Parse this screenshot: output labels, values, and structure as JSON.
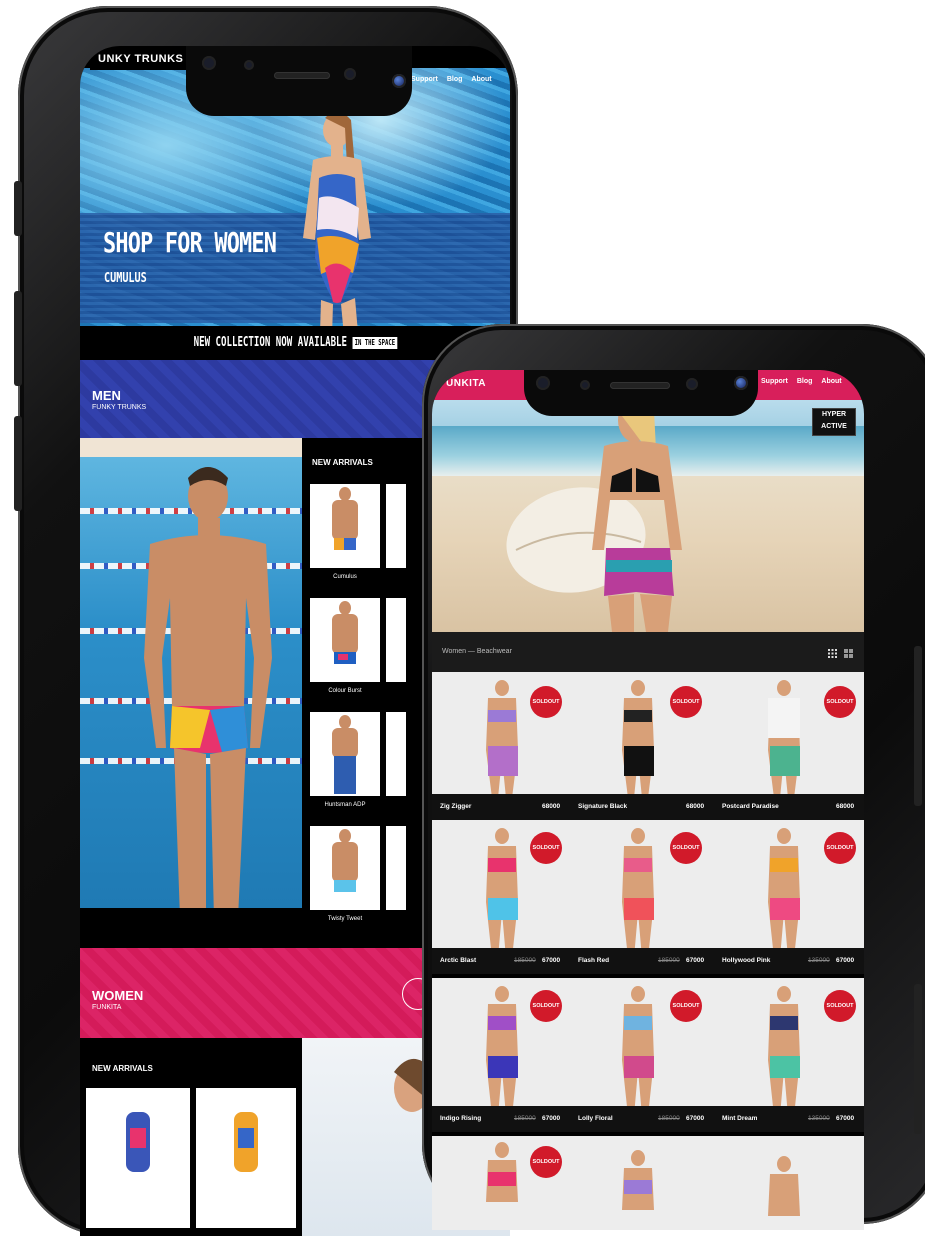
{
  "phone1": {
    "brand": "UNKY TRUNKS",
    "nav": [
      "Support",
      "Blog",
      "About"
    ],
    "hero": {
      "title": "SHOP FOR WOMEN",
      "subtitle": "CUMULUS"
    },
    "banner": {
      "text": "NEW COLLECTION NOW AVAILABLE",
      "logo": "IN THE SPACE"
    },
    "men": {
      "title": "MEN",
      "subtitle": "FUNKY TRUNKS"
    },
    "new_arrivals_title": "NEW ARRIVALS",
    "men_products": [
      "Cumulus",
      "Colour Burst",
      "Huntsman ADP",
      "Twisty Tweet"
    ],
    "women": {
      "title": "WOMEN",
      "subtitle": "FUNKITA"
    },
    "women_arrivals_title": "NEW ARRIVALS"
  },
  "phone2": {
    "brand": "UNKITA",
    "nav": [
      "Support",
      "Blog",
      "About"
    ],
    "hyper_logo": [
      "HYPER",
      "ACTIVE"
    ],
    "breadcrumb": "Women — Beachwear",
    "soldout_label": "SOLDOUT",
    "rows": [
      [
        {
          "name": "Zig Zigger",
          "old": "",
          "price": "68000"
        },
        {
          "name": "Signature Black",
          "old": "",
          "price": "68000"
        },
        {
          "name": "Postcard Paradise",
          "old": "",
          "price": "68000"
        }
      ],
      [
        {
          "name": "Arctic Blast",
          "old": "185000",
          "price": "67000"
        },
        {
          "name": "Flash Red",
          "old": "185000",
          "price": "67000"
        },
        {
          "name": "Hollywood Pink",
          "old": "135000",
          "price": "67000"
        }
      ],
      [
        {
          "name": "Indigo Rising",
          "old": "185000",
          "price": "67000"
        },
        {
          "name": "Lolly Floral",
          "old": "185000",
          "price": "67000"
        },
        {
          "name": "Mint Dream",
          "old": "135000",
          "price": "67000"
        }
      ]
    ]
  },
  "colors": {
    "men_blue": "#2d3aa0",
    "women_pink": "#d81f5b",
    "soldout_red": "#d11a2a"
  }
}
